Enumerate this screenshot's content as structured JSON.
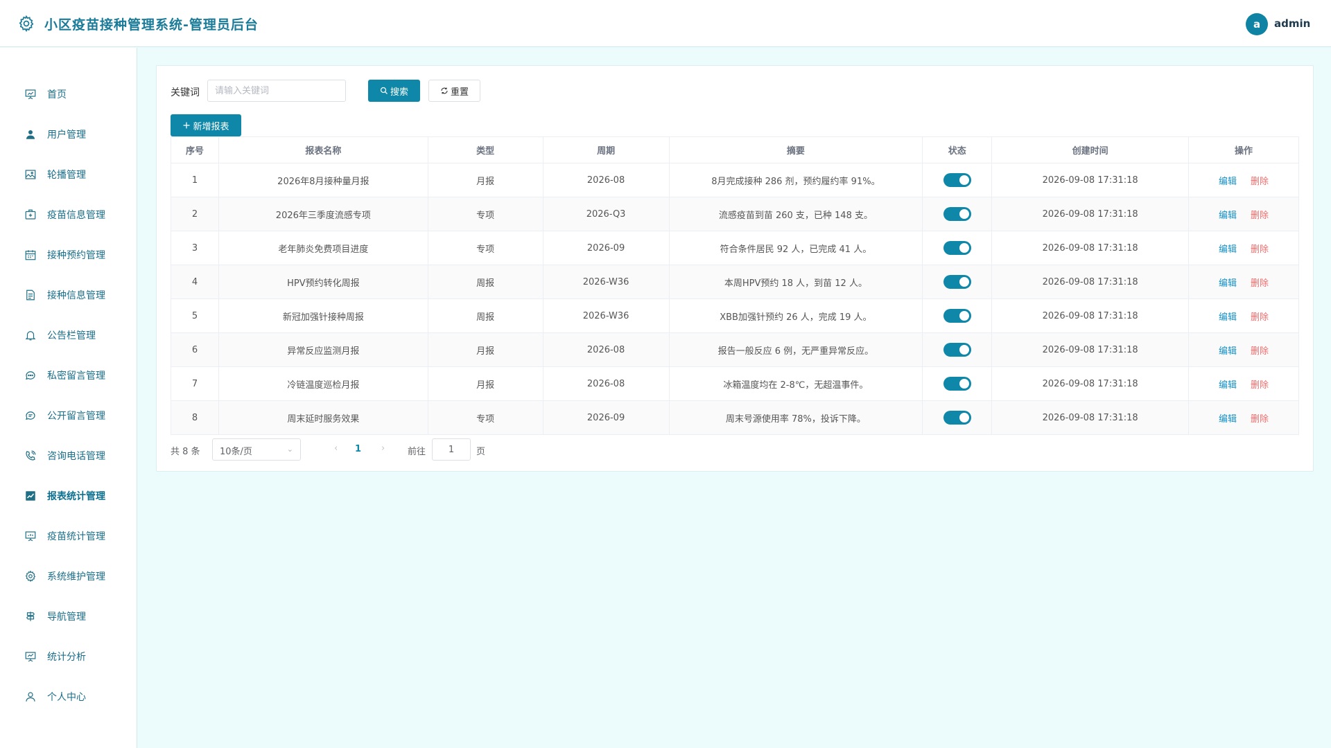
{
  "header": {
    "title": "小区疫苗接种管理系统-管理员后台",
    "avatar_letter": "a",
    "username": "admin"
  },
  "sidebar": {
    "items": [
      {
        "label": "首页",
        "icon": "presentation-icon"
      },
      {
        "label": "用户管理",
        "icon": "user-filled-icon"
      },
      {
        "label": "轮播管理",
        "icon": "picture-icon"
      },
      {
        "label": "疫苗信息管理",
        "icon": "first-aid-kit-icon"
      },
      {
        "label": "接种预约管理",
        "icon": "calendar-icon"
      },
      {
        "label": "接种信息管理",
        "icon": "document-icon"
      },
      {
        "label": "公告栏管理",
        "icon": "bell-icon"
      },
      {
        "label": "私密留言管理",
        "icon": "chat-dots-icon"
      },
      {
        "label": "公开留言管理",
        "icon": "chat-line-icon"
      },
      {
        "label": "咨询电话管理",
        "icon": "phone-icon"
      },
      {
        "label": "报表统计管理",
        "icon": "trend-chart-icon"
      },
      {
        "label": "疫苗统计管理",
        "icon": "data-board-icon"
      },
      {
        "label": "系统维护管理",
        "icon": "gear-icon"
      },
      {
        "label": "导航管理",
        "icon": "guide-icon"
      },
      {
        "label": "统计分析",
        "icon": "data-analysis-icon"
      },
      {
        "label": "个人中心",
        "icon": "user-icon"
      }
    ],
    "active_index": 10
  },
  "search": {
    "label": "关键词",
    "placeholder": "请输入关键词",
    "value": "",
    "search_button": "搜索",
    "reset_button": "重置",
    "add_button": "新增报表"
  },
  "table": {
    "columns": [
      "序号",
      "报表名称",
      "类型",
      "周期",
      "摘要",
      "状态",
      "创建时间",
      "操作"
    ],
    "rows": [
      {
        "no": "1",
        "name": "2026年8月接种量月报",
        "type": "月报",
        "period": "2026-08",
        "summary": "8月完成接种 286 剂，预约履约率 91%。",
        "enabled": true,
        "created": "2026-09-08 17:31:18"
      },
      {
        "no": "2",
        "name": "2026年三季度流感专项",
        "type": "专项",
        "period": "2026-Q3",
        "summary": "流感疫苗到苗 260 支，已种 148 支。",
        "enabled": true,
        "created": "2026-09-08 17:31:18"
      },
      {
        "no": "3",
        "name": "老年肺炎免费项目进度",
        "type": "专项",
        "period": "2026-09",
        "summary": "符合条件居民 92 人，已完成 41 人。",
        "enabled": true,
        "created": "2026-09-08 17:31:18"
      },
      {
        "no": "4",
        "name": "HPV预约转化周报",
        "type": "周报",
        "period": "2026-W36",
        "summary": "本周HPV预约 18 人，到苗 12 人。",
        "enabled": true,
        "created": "2026-09-08 17:31:18"
      },
      {
        "no": "5",
        "name": "新冠加强针接种周报",
        "type": "周报",
        "period": "2026-W36",
        "summary": "XBB加强针预约 26 人，完成 19 人。",
        "enabled": true,
        "created": "2026-09-08 17:31:18"
      },
      {
        "no": "6",
        "name": "异常反应监测月报",
        "type": "月报",
        "period": "2026-08",
        "summary": "报告一般反应 6 例，无严重异常反应。",
        "enabled": true,
        "created": "2026-09-08 17:31:18"
      },
      {
        "no": "7",
        "name": "冷链温度巡检月报",
        "type": "月报",
        "period": "2026-08",
        "summary": "冰箱温度均在 2-8℃，无超温事件。",
        "enabled": true,
        "created": "2026-09-08 17:31:18"
      },
      {
        "no": "8",
        "name": "周末延时服务效果",
        "type": "专项",
        "period": "2026-09",
        "summary": "周末号源使用率 78%，投诉下降。",
        "enabled": true,
        "created": "2026-09-08 17:31:18"
      }
    ],
    "edit_label": "编辑",
    "delete_label": "删除"
  },
  "pagination": {
    "total_text": "共 8 条",
    "page_size": "10条/页",
    "current_page": "1",
    "goto_label": "前往",
    "goto_value": "1",
    "page_suffix": "页"
  },
  "colors": {
    "accent": "#0f87a8",
    "title": "#1a7b98",
    "background": "#ecfbfc",
    "danger": "#f56c6c",
    "link": "#1591c7"
  }
}
